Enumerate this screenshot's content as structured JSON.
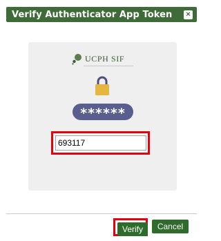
{
  "dialog": {
    "title": "Verify Authenticator App Token",
    "close_glyph": "×"
  },
  "card": {
    "logo_text": "UCPH SIF",
    "masked_password": "******"
  },
  "token_input": {
    "value": "693117"
  },
  "footer": {
    "verify_label": "Verify",
    "cancel_label": "Cancel"
  },
  "colors": {
    "title_bar": "#3f6b38",
    "button": "#2f6b2a",
    "highlight": "#e3000f",
    "pill": "#5a5e8f",
    "lock": "#e6b642"
  },
  "icons": [
    "close-icon",
    "ucph-sif-logo-icon",
    "lock-icon"
  ]
}
